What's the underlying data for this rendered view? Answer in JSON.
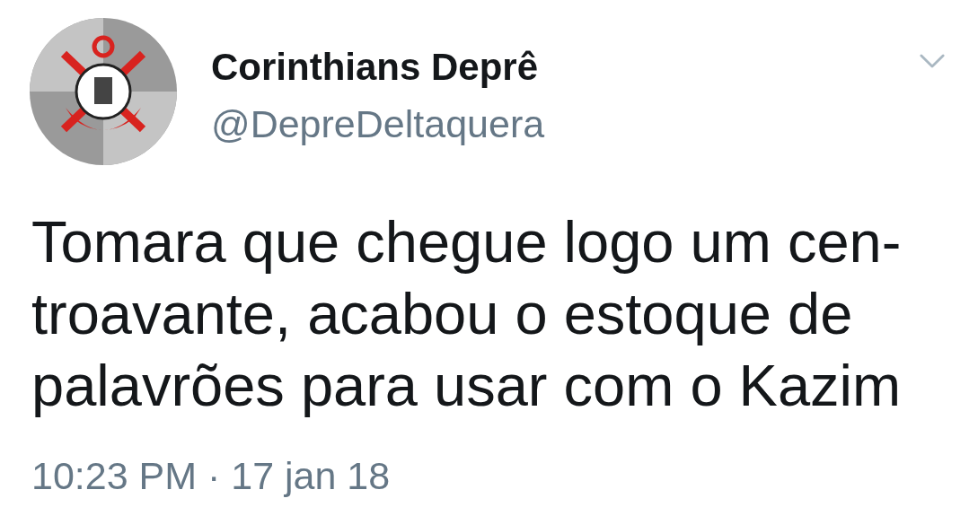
{
  "tweet": {
    "author": {
      "name": "Corinthians Deprê",
      "handle": "@DepreDeltaquera"
    },
    "text_lines": [
      "Tomara que chegue logo um cen-",
      "troavante, acabou o estoque de",
      "palavrões para usar com o Kazim"
    ],
    "timestamp": "10:23 PM · 17 jan 18"
  }
}
